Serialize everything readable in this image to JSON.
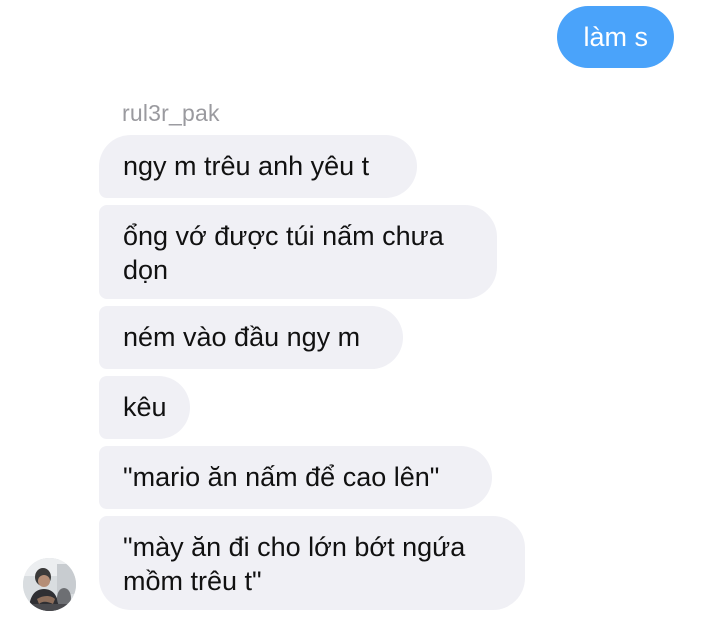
{
  "conversation": {
    "outgoing": [
      {
        "text": "làm s"
      }
    ],
    "incoming": {
      "sender": "rul3r_pak",
      "messages": [
        "ngy m trêu anh yêu t",
        "ổng vớ được túi nấm chưa dọn",
        "ném vào đầu ngy m",
        "kêu",
        "\"mario ăn nấm để cao lên\"",
        "\"mày ăn đi cho lớn bớt ngứa mồm trêu t\""
      ]
    }
  },
  "colors": {
    "outgoing_bubble": "#4aa3fa",
    "incoming_bubble": "#f0f0f5",
    "sender_label": "#9a9a9f"
  },
  "icons": {
    "avatar": "user-avatar-photo"
  }
}
